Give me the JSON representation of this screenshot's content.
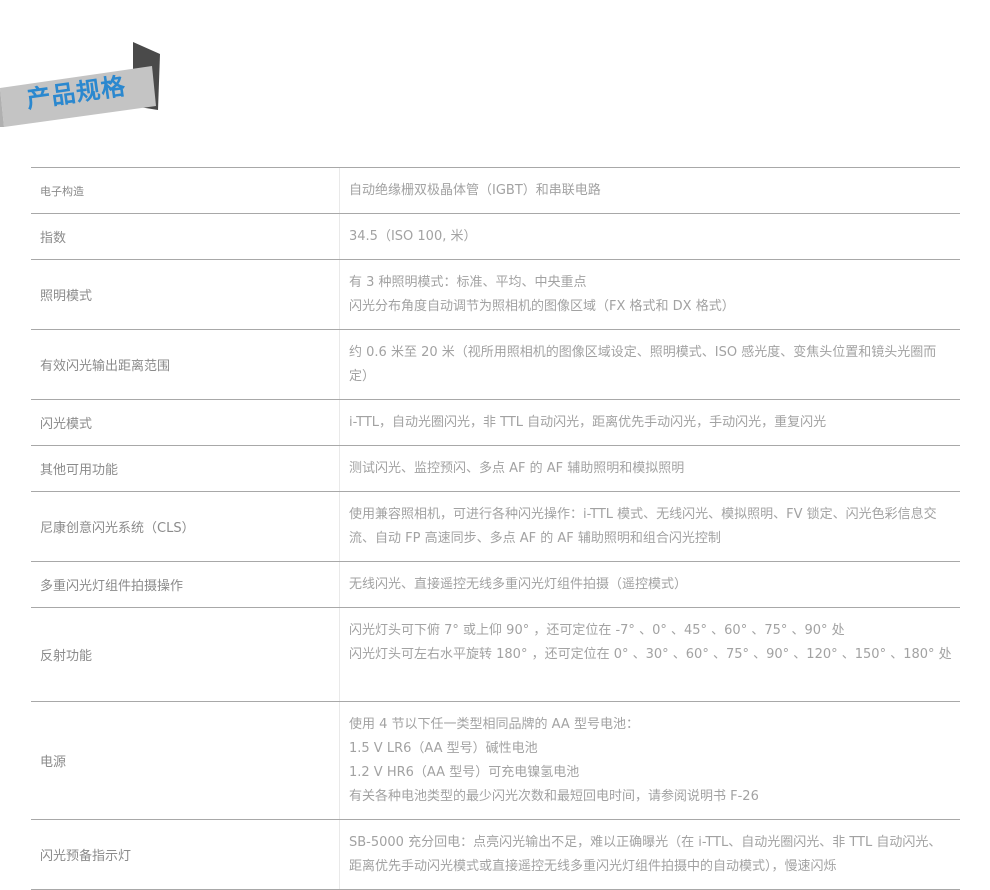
{
  "header": {
    "title": "产品规格"
  },
  "colors": {
    "title": "#2b88cf",
    "ribbon": "#c4c4c4",
    "ribbon_fold": "#4a4a4a",
    "label_text": "#8b8b8b",
    "value_text": "#a2a2a2",
    "rule": "#a8a8a8"
  },
  "specs": [
    {
      "label": "电子构造",
      "lines": [
        "自动绝缘栅双极晶体管（IGBT）和串联电路"
      ]
    },
    {
      "label": "指数",
      "lines": [
        "34.5（ISO 100, 米）"
      ]
    },
    {
      "label": "照明模式",
      "lines": [
        "有 3 种照明模式：标准、平均、中央重点",
        "闪光分布角度自动调节为照相机的图像区域（FX 格式和 DX 格式）"
      ]
    },
    {
      "label": "有效闪光输出距离范围",
      "lines": [
        "约 0.6 米至 20 米（视所用照相机的图像区域设定、照明模式、ISO 感光度、变焦头位置和镜头光圈而定）"
      ]
    },
    {
      "label": "闪光模式",
      "lines": [
        "i-TTL，自动光圈闪光，非 TTL 自动闪光，距离优先手动闪光，手动闪光，重复闪光"
      ]
    },
    {
      "label": "其他可用功能",
      "lines": [
        "测试闪光、监控预闪、多点 AF 的 AF 辅助照明和模拟照明"
      ]
    },
    {
      "label": "尼康创意闪光系统（CLS）",
      "lines": [
        "使用兼容照相机，可进行各种闪光操作：i-TTL 模式、无线闪光、模拟照明、FV 锁定、闪光色彩信息交流、自动 FP 高速同步、多点 AF 的 AF 辅助照明和组合闪光控制"
      ]
    },
    {
      "label": "多重闪光灯组件拍摄操作",
      "lines": [
        "无线闪光、直接遥控无线多重闪光灯组件拍摄（遥控模式）"
      ]
    },
    {
      "label": "反射功能",
      "lines": [
        "闪光灯头可下俯 7°  或上仰 90°  ，还可定位在 -7°  、0°  、45°  、60°  、75°  、90°  处",
        "闪光灯头可左右水平旋转 180°  ，还可定位在 0°  、30°  、60°  、75°  、90°  、120°  、150°  、180°  处"
      ]
    },
    {
      "label": "电源",
      "lines": [
        "使用 4 节以下任一类型相同品牌的 AA 型号电池：",
        "1.5 V LR6（AA 型号）碱性电池",
        "1.2 V HR6（AA 型号）可充电镍氢电池",
        "有关各种电池类型的最少闪光次数和最短回电时间，请参阅说明书 F-26"
      ]
    },
    {
      "label": "闪光预备指示灯",
      "lines": [
        "SB-5000 充分回电：点亮闪光输出不足，难以正确曝光（在 i-TTL、自动光圈闪光、非 TTL 自动闪光、距离优先手动闪光模式或直接遥控无线多重闪光灯组件拍摄中的自动模式），慢速闪烁"
      ]
    }
  ]
}
